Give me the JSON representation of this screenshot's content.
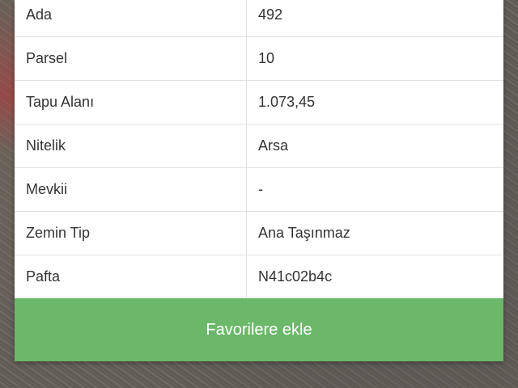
{
  "colors": {
    "button_bg": "#6cb86a",
    "button_text": "#ffffff",
    "text": "#333333",
    "border": "#e2e2e2"
  },
  "table": {
    "rows": [
      {
        "label": "Ada",
        "value": "492"
      },
      {
        "label": "Parsel",
        "value": "10"
      },
      {
        "label": "Tapu Alanı",
        "value": "1.073,45"
      },
      {
        "label": "Nitelik",
        "value": "Arsa"
      },
      {
        "label": "Mevkii",
        "value": "-"
      },
      {
        "label": "Zemin Tip",
        "value": "Ana Taşınmaz"
      },
      {
        "label": "Pafta",
        "value": "N41c02b4c"
      }
    ]
  },
  "button": {
    "label": "Favorilere ekle"
  }
}
